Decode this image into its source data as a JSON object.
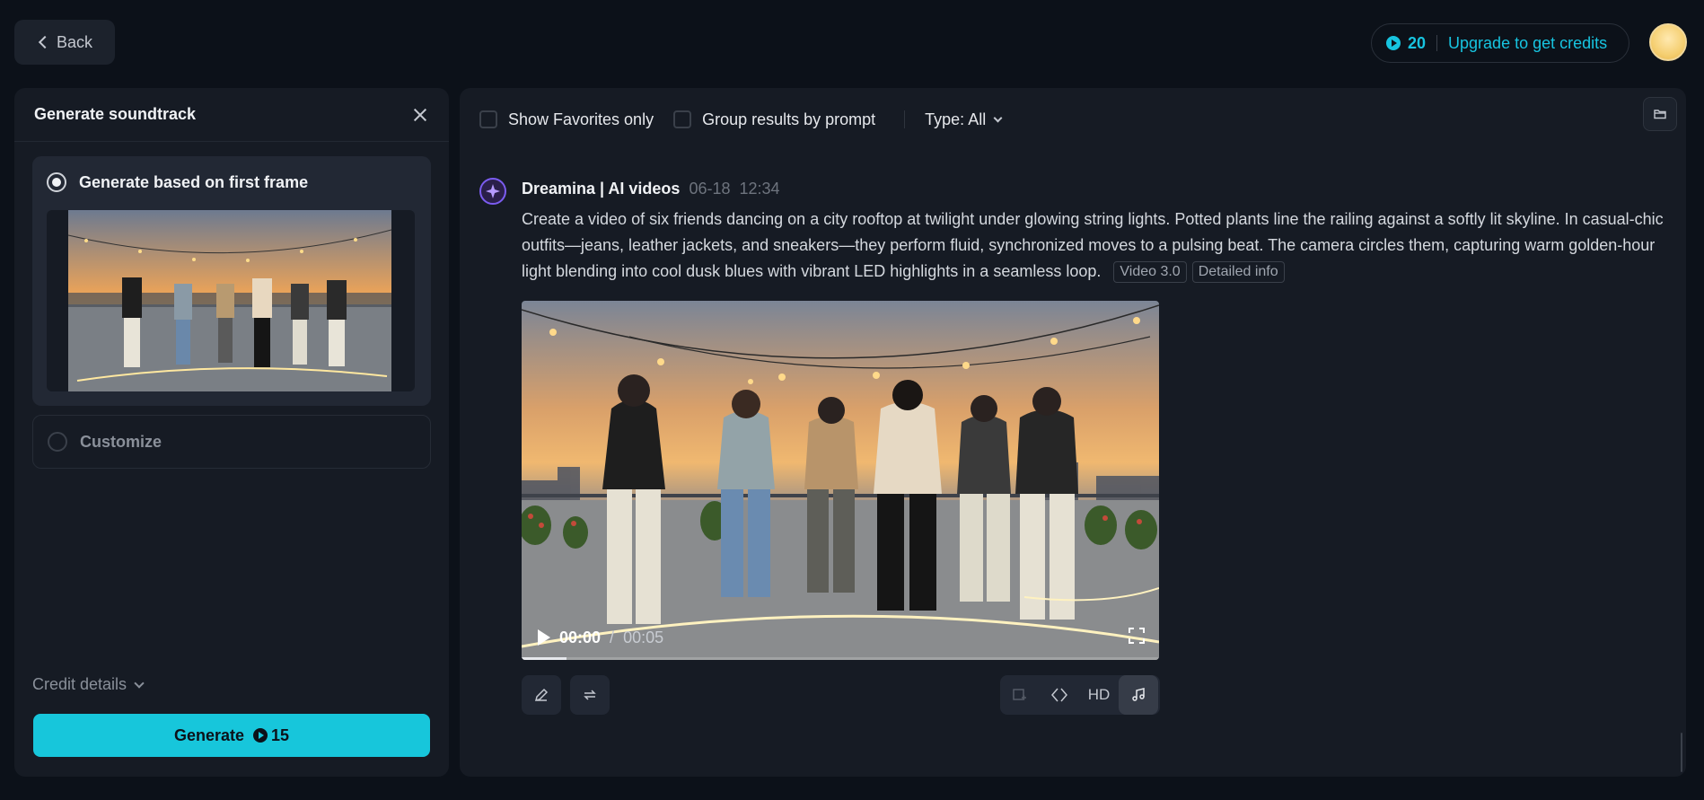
{
  "header": {
    "back_label": "Back",
    "credits": "20",
    "upgrade_label": "Upgrade to get credits"
  },
  "soundtrack_panel": {
    "title": "Generate soundtrack",
    "options": [
      {
        "label": "Generate based on first frame",
        "selected": true
      },
      {
        "label": "Customize",
        "selected": false
      }
    ],
    "credit_details_label": "Credit details",
    "generate_label": "Generate",
    "generate_cost": "15"
  },
  "filters": {
    "favorites_label": "Show Favorites only",
    "group_label": "Group results by prompt",
    "type_label": "Type: All"
  },
  "result": {
    "author": "Dreamina | AI videos",
    "date": "06-18",
    "time": "12:34",
    "prompt": "Create a video of six friends dancing on a city rooftop at twilight under glowing string lights. Potted plants line the railing against a softly lit skyline. In casual-chic outfits—jeans, leather jackets, and sneakers—they perform fluid, synchronized moves to a pulsing beat. The camera circles them, capturing warm golden-hour light blending into cool dusk blues with vibrant LED highlights in a seamless loop.",
    "tags": [
      "Video 3.0",
      "Detailed info"
    ],
    "video": {
      "current_time": "00:00",
      "separator": "/",
      "duration": "00:05",
      "progress": 0.07
    },
    "toolbar": {
      "hd_label": "HD"
    }
  },
  "colors": {
    "accent": "#17c6db",
    "background": "#0c1119",
    "panel": "#161b24"
  },
  "icons": [
    "chevron-left-icon",
    "coin-icon",
    "close-icon",
    "radio-icon",
    "chevron-down-icon",
    "folder-icon",
    "dreamina-logo-icon",
    "play-icon",
    "fullscreen-icon",
    "edit-icon",
    "regenerate-icon",
    "frame-interpolation-icon",
    "extend-icon",
    "music-icon"
  ]
}
